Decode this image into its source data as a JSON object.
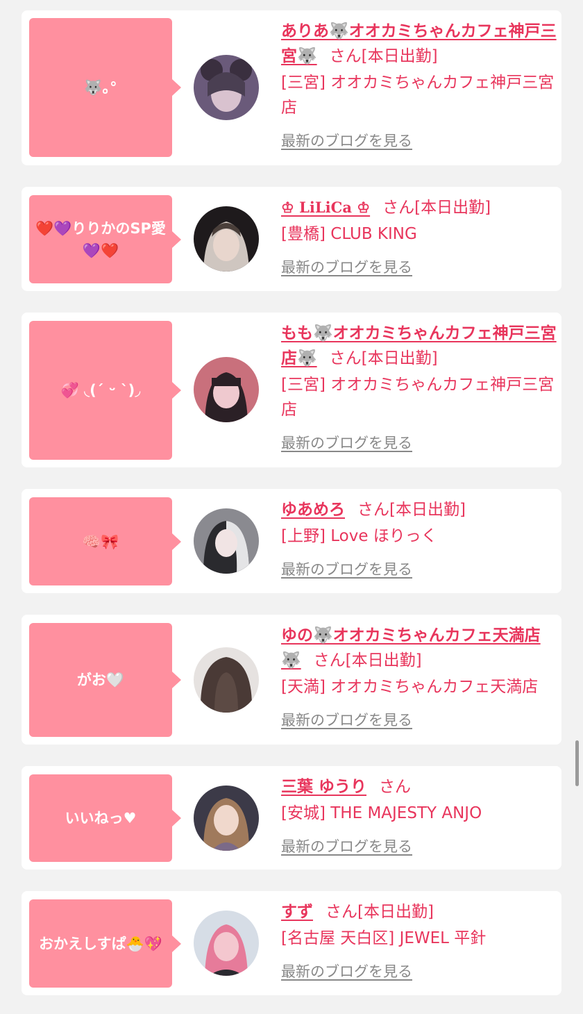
{
  "theme": {
    "accent": "#e8355c",
    "bubble_bg": "#ff909f",
    "page_bg": "#f2f2f2",
    "link_gray": "#888888"
  },
  "blog_link_label": "最新のブログを見る",
  "entries": [
    {
      "bubble": "🐺｡°",
      "name": "ありあ🐺オオカミちゃんカフェ神戸三宮🐺",
      "suffix": "さん[本日出勤]",
      "shop": "[三宮] オオカミちゃんカフェ神戸三宮店",
      "avatar_icon": "profile-photo",
      "avatar_colors": [
        "#6a5a7a",
        "#d9c2cf",
        "#3a2f3f"
      ]
    },
    {
      "bubble": "❤️💜りりかのSP愛💜❤️",
      "name": "♔ LiLiCa ♔",
      "suffix": "さん[本日出勤]",
      "shop": "[豊橋] CLUB KING",
      "avatar_icon": "profile-photo",
      "avatar_colors": [
        "#1e1a1c",
        "#cfc6c0",
        "#4a3f3a"
      ]
    },
    {
      "bubble": "💞 ◟(ˊ ᵕ ˋ)◞",
      "name": "もも🐺オオカミちゃんカフェ神戸三宮店🐺",
      "suffix": "さん[本日出勤]",
      "shop": "[三宮] オオカミちゃんカフェ神戸三宮店",
      "avatar_icon": "profile-photo",
      "avatar_colors": [
        "#c9707c",
        "#efc9cf",
        "#2b2026"
      ]
    },
    {
      "bubble": "🧠🎀",
      "name": "ゆあめろ",
      "suffix": "さん[本日出勤]",
      "shop": "[上野] Love ほりっく",
      "avatar_icon": "profile-photo",
      "avatar_colors": [
        "#2a2a2e",
        "#e4e4e6",
        "#8a8a90"
      ]
    },
    {
      "bubble": "がお🤍",
      "name": "ゆの🐺オオカミちゃんカフェ天満店🐺",
      "suffix": "さん[本日出勤]",
      "shop": "[天満] オオカミちゃんカフェ天満店",
      "avatar_icon": "profile-photo",
      "avatar_colors": [
        "#b9b2b0",
        "#e6e2e0",
        "#4a3a36"
      ]
    },
    {
      "bubble": "いいねっ♥",
      "name": "三葉 ゆうり",
      "suffix": "さん",
      "shop": "[安城] THE MAJESTY ANJO",
      "avatar_icon": "profile-photo",
      "avatar_colors": [
        "#3c3a48",
        "#f0d8cc",
        "#7b6a88"
      ]
    },
    {
      "bubble": "おかえしすぱ🐣💖",
      "name": "すず",
      "suffix": "さん[本日出勤]",
      "shop": "[名古屋 天白区] JEWEL 平針",
      "avatar_icon": "profile-photo",
      "avatar_colors": [
        "#d6dde6",
        "#f4c7cf",
        "#2a2a30"
      ]
    }
  ]
}
